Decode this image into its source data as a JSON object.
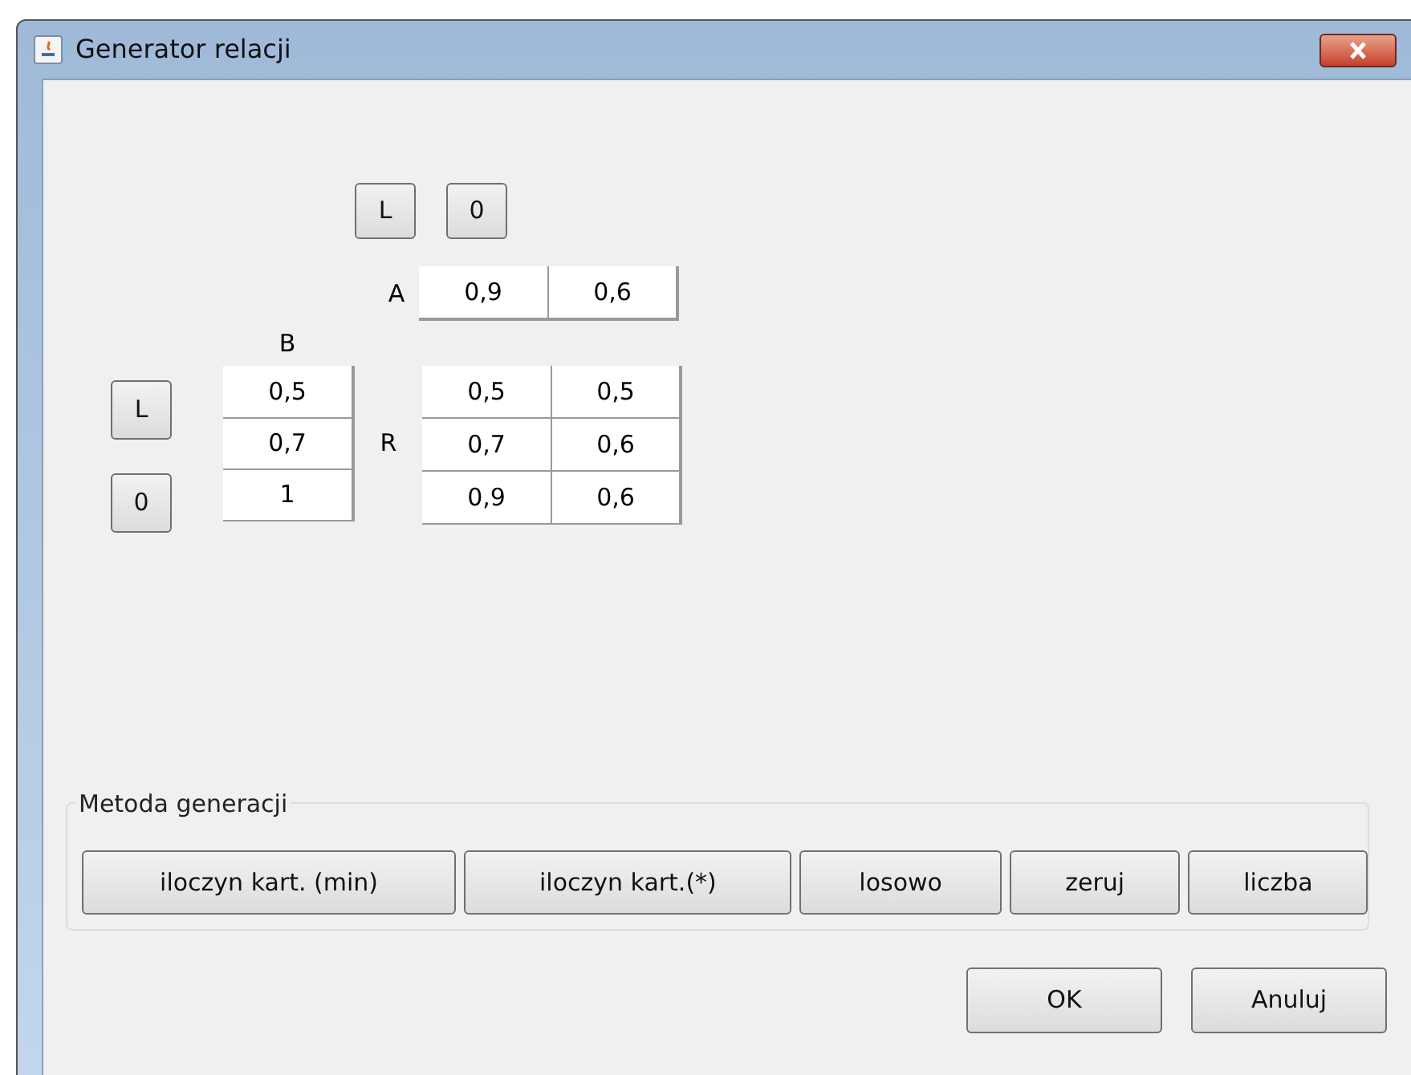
{
  "window": {
    "title": "Generator relacji"
  },
  "top_buttons": [
    "L",
    "0"
  ],
  "a_label": "A",
  "a_values": [
    "0,9",
    "0,6"
  ],
  "b_label": "B",
  "b_values": [
    "0,5",
    "0,7",
    "1"
  ],
  "side_buttons": [
    "L",
    "0"
  ],
  "r_label": "R",
  "r_rows": [
    [
      "0,5",
      "0,5"
    ],
    [
      "0,7",
      "0,6"
    ],
    [
      "0,9",
      "0,6"
    ]
  ],
  "method_group": {
    "title": "Metoda generacji",
    "buttons": [
      "iloczyn kart. (min)",
      "iloczyn kart.(*)",
      "losowo",
      "zeruj",
      "liczba"
    ]
  },
  "dialog_buttons": [
    "OK",
    "Anuluj"
  ]
}
